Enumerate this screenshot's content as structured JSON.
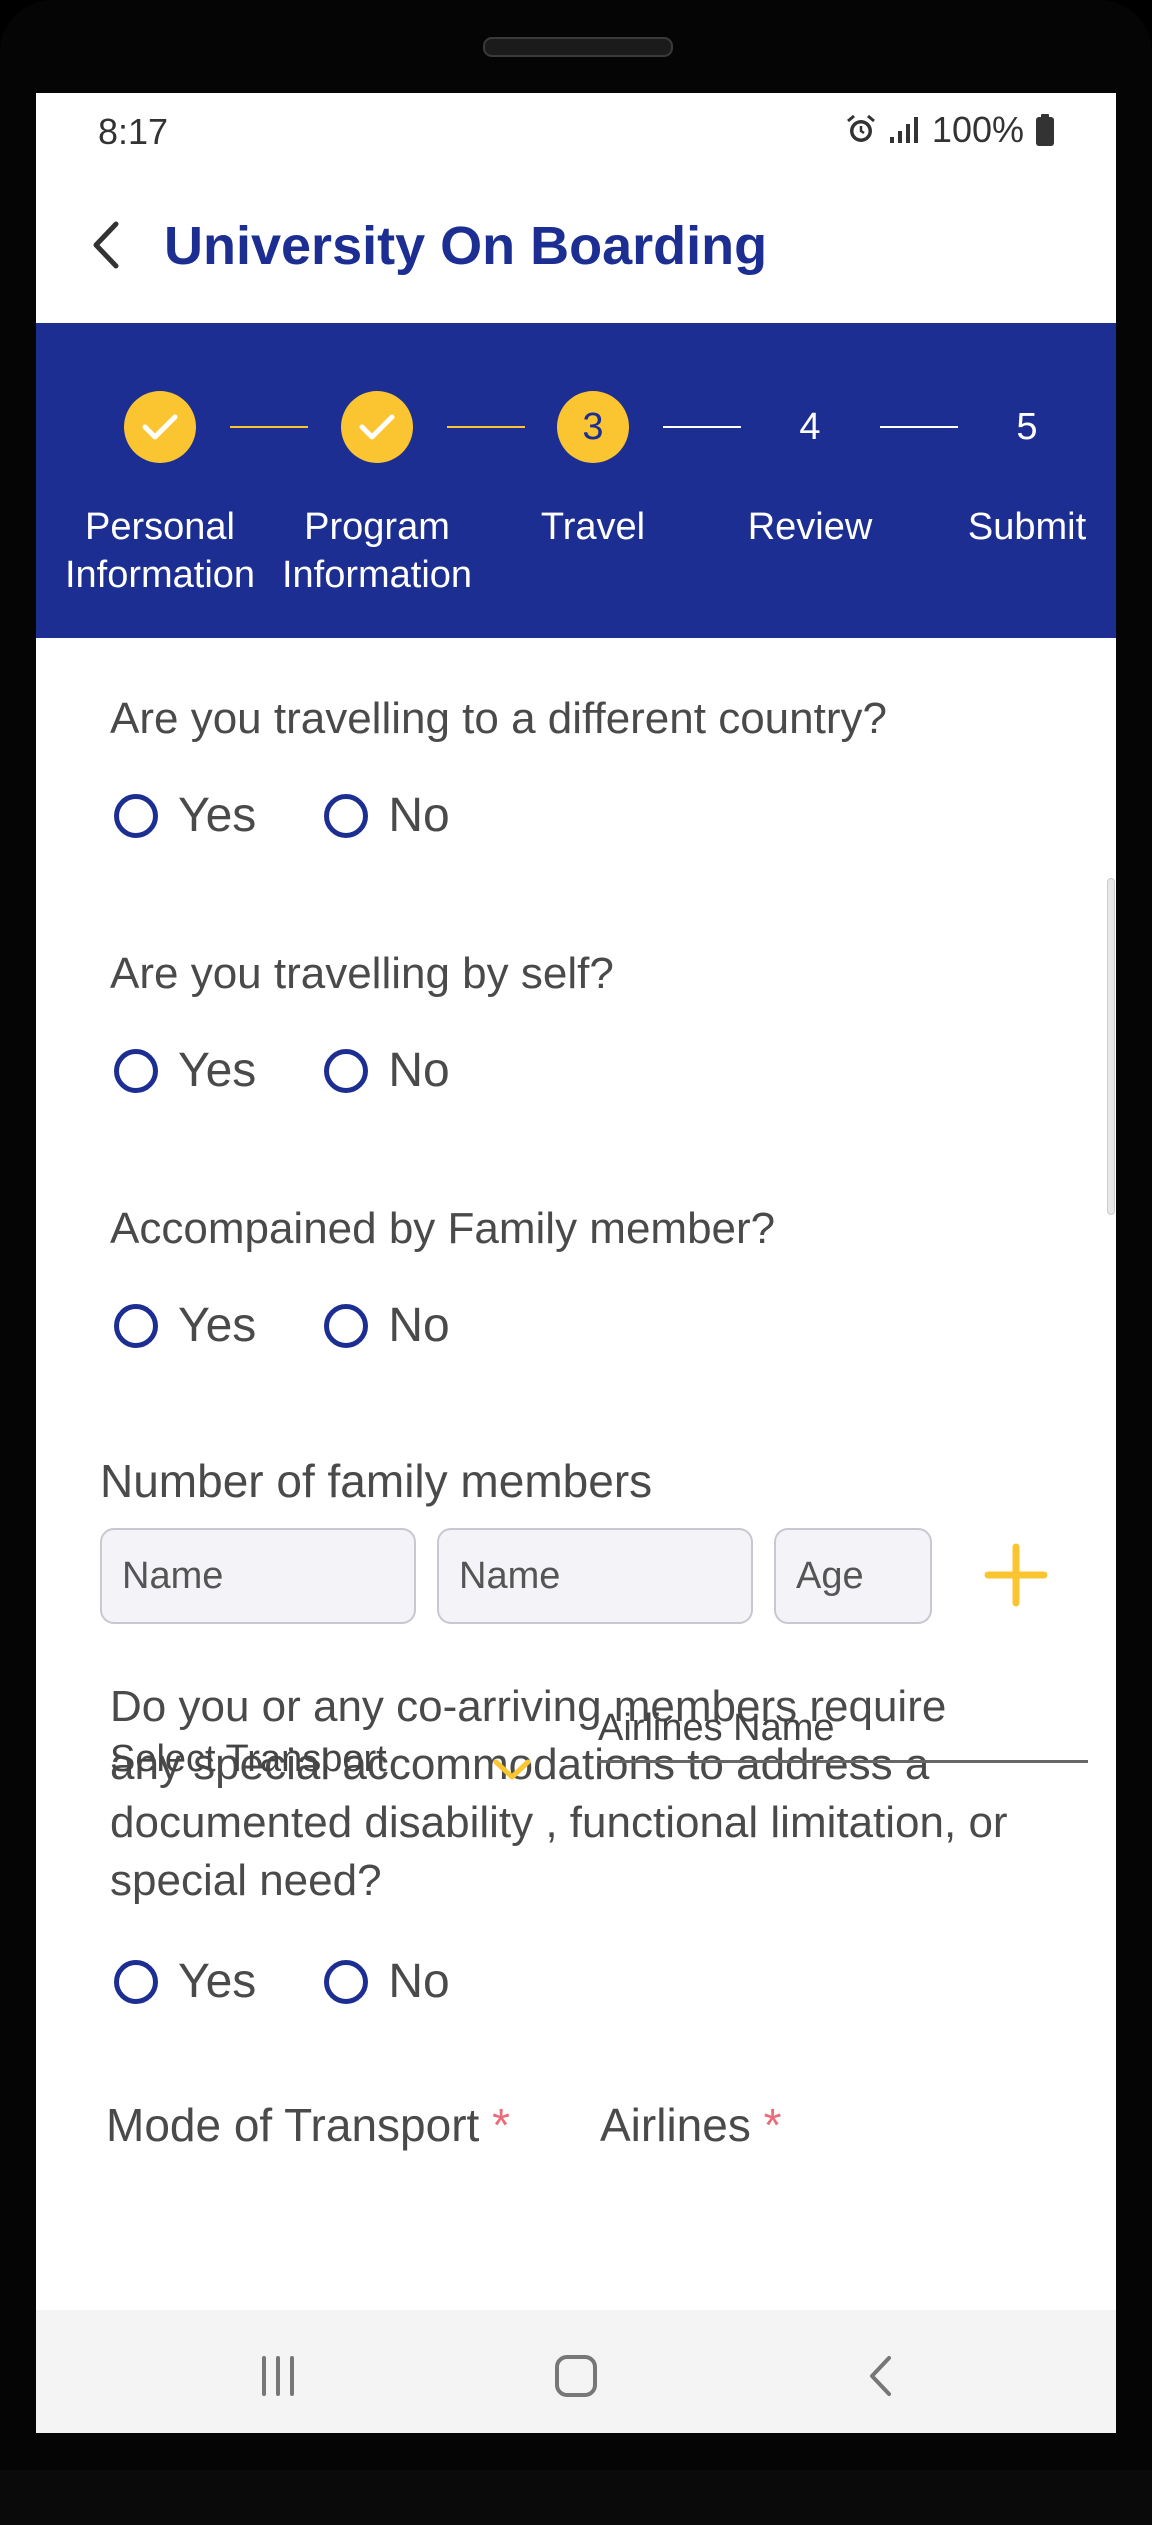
{
  "status": {
    "time": "8:17",
    "battery": "100%"
  },
  "header": {
    "title": "University On Boarding"
  },
  "stepper": {
    "steps": [
      {
        "number": "1",
        "label_line1": "Personal",
        "label_line2": "Information",
        "state": "done"
      },
      {
        "number": "2",
        "label_line1": "Program",
        "label_line2": "Information",
        "state": "done"
      },
      {
        "number": "3",
        "label_line1": "Travel",
        "label_line2": "",
        "state": "active"
      },
      {
        "number": "4",
        "label_line1": "Review",
        "label_line2": "",
        "state": "pending"
      },
      {
        "number": "5",
        "label_line1": "Submit",
        "label_line2": "",
        "state": "pending"
      }
    ],
    "colors": {
      "bar": "#1d2e93",
      "accent": "#fbc531"
    }
  },
  "questions": [
    {
      "text": "Are you travelling to a different country?",
      "options": [
        "Yes",
        "No"
      ]
    },
    {
      "text": "Are you travelling by self?",
      "options": [
        "Yes",
        "No"
      ]
    },
    {
      "text": "Accompained by Family member?",
      "options": [
        "Yes",
        "No"
      ]
    },
    {
      "text": "Do you or any co-arriving members require any special accommodations to address a documented disability , functional limitation, or special need?",
      "options": [
        "Yes",
        "No"
      ]
    }
  ],
  "family": {
    "label": "Number of family members",
    "name1_placeholder": "Name",
    "name2_placeholder": "Name",
    "age_placeholder": "Age",
    "add_icon": "plus-icon"
  },
  "transport": {
    "label": "Mode of Transport",
    "required_mark": "*",
    "select_value": "Select Transport"
  },
  "airlines": {
    "label": "Airlines",
    "required_mark": "*",
    "placeholder": "Airlines Name"
  },
  "navigation": {
    "icons": [
      "recent-apps-icon",
      "home-icon",
      "back-icon"
    ]
  }
}
